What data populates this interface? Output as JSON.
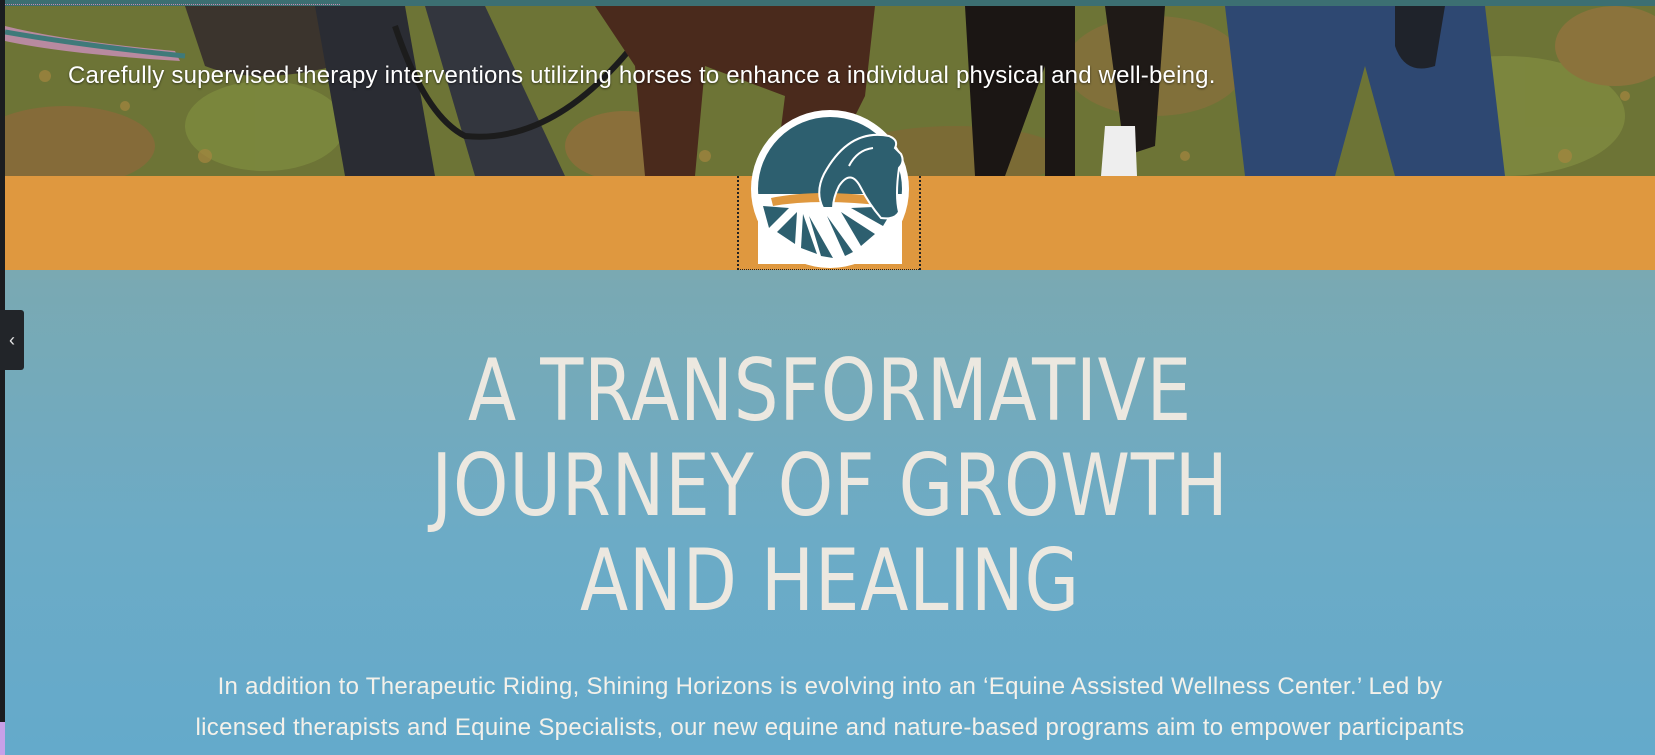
{
  "hero": {
    "caption": "Carefully supervised therapy interventions utilizing horses to enhance a individual physical and well-being."
  },
  "logo": {
    "name": "Shining Horizons logo"
  },
  "section": {
    "headline_lines": [
      "A TRANSFORMATIVE",
      "JOURNEY OF GROWTH",
      "AND HEALING"
    ],
    "body_lines": [
      "In addition to Therapeutic Riding, Shining Horizons is evolving into an ‘Equine Assisted Wellness Center.’ Led by",
      "licensed therapists and Equine Specialists, our new equine and nature-based programs aim to empower participants"
    ]
  },
  "sidebar_toggle": {
    "label": "‹",
    "icon": "chevron-left-icon"
  },
  "colors": {
    "band": "#df983f",
    "teal": "#2d5f6f",
    "headline": "#ece8e0"
  }
}
